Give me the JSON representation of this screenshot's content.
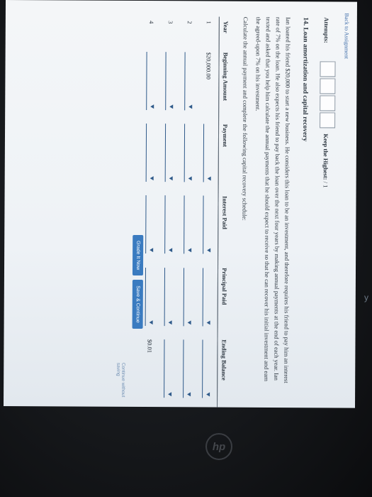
{
  "nav": {
    "back_label": "Back to Assignment"
  },
  "attempts": {
    "label": "Attempts:",
    "keep_label": "Keep the Highest:",
    "keep_value": "/ 1"
  },
  "question": {
    "title": "14. Loan amortization and capital recovery",
    "body": "Ian loaned his friend $20,000 to start a new business. He considers this loan to be an investment, and therefore requires his friend to pay him an interest rate of 7% on the loan. He also expects his friend to pay back the loan over the next four years by making annual payments at the end of each year. Ian texted and asked that you help him calculate the annual payments that he should expect to receive so that he can recover his initial investment and earn the agreed-upon 7% on his investment.",
    "instruction": "Calculate the annual payment and complete the following capital recovery schedule:"
  },
  "table": {
    "headers": [
      "Year",
      "Beginning Amount",
      "Payment",
      "Interest Paid",
      "Principal Paid",
      "Ending Balance"
    ],
    "rows": [
      {
        "year": "1",
        "beginning": "$20,000.00",
        "ending": ""
      },
      {
        "year": "2",
        "beginning": "",
        "ending": ""
      },
      {
        "year": "3",
        "beginning": "",
        "ending": ""
      },
      {
        "year": "4",
        "beginning": "",
        "ending": "$0.01"
      }
    ]
  },
  "buttons": {
    "grade": "Grade It Now",
    "save": "Save & Continue",
    "continue": "Continue without saving"
  },
  "device": {
    "logo": "hp",
    "side_glyph": "y"
  }
}
